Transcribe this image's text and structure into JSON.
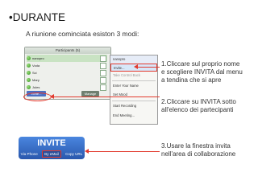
{
  "heading": {
    "bullet": "•",
    "title": "DURANTE",
    "subtitle": "A riunione cominciata esiston 3 modi:"
  },
  "participants_panel": {
    "header": "Participants (5)",
    "rows": [
      "nanopro",
      "Voda",
      "Sci",
      "Mary",
      "Jules"
    ],
    "invite_label": "Invite...",
    "manage_label": "Manage"
  },
  "menu": {
    "items": [
      "nanopro",
      "Invite...",
      "Take Control Back",
      "Enter Your Name",
      "Set Mood",
      "Start Recording",
      "End Meeting..."
    ]
  },
  "notes": {
    "n1": [
      "1.Cliccare sul proprio nome",
      "e scegliere INVITA dal menu",
      "a tendina che si apre"
    ],
    "n2": [
      "2.Cliccare su INVITA sotto",
      "all'elenco dei partecipanti"
    ],
    "n3": [
      "3.Usare la finestra invita",
      "nell'area di collaborazione"
    ]
  },
  "invite_panel": {
    "title": "INVITE",
    "options": [
      "Via Phone",
      "By eMail",
      "Copy URL"
    ]
  },
  "colors": {
    "annotation": "#e23a2e",
    "invite_blue": "#2a58ad"
  }
}
